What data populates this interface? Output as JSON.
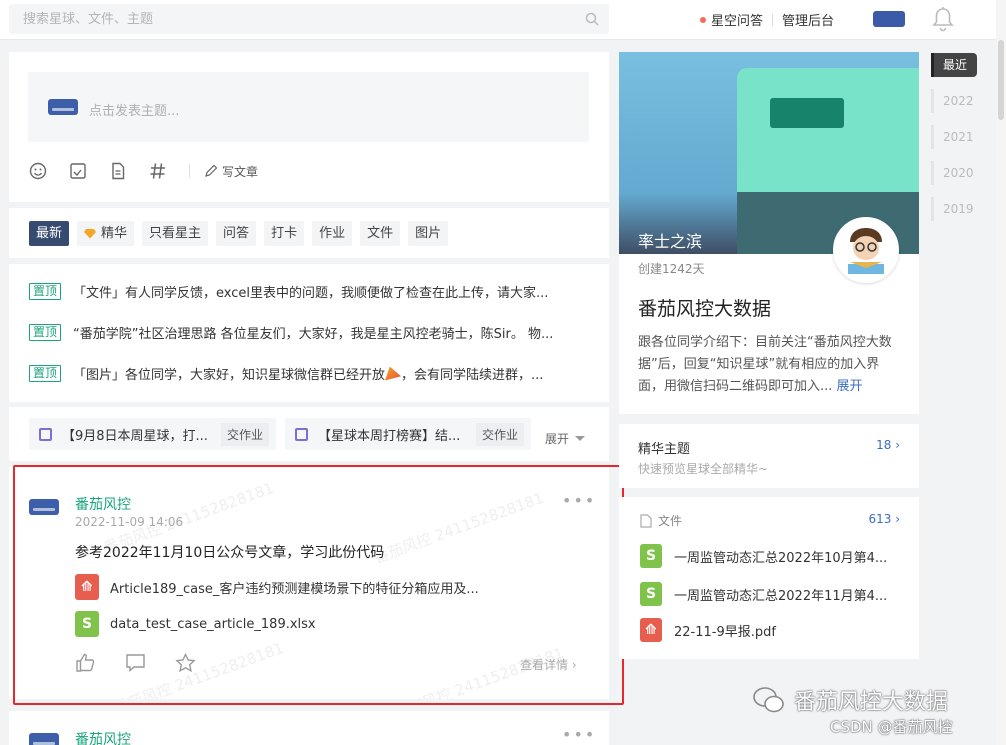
{
  "search": {
    "placeholder": "搜索星球、文件、主题"
  },
  "topnav": {
    "qa": "星空问答",
    "admin": "管理后台"
  },
  "composer": {
    "placeholder": "点击发表主题...",
    "write_article": "写文章"
  },
  "tabs": [
    "最新",
    "精华",
    "只看星主",
    "问答",
    "打卡",
    "作业",
    "文件",
    "图片"
  ],
  "pinned": {
    "tag": "置顶",
    "items": [
      "「文件」有人同学反馈，excel里表中的问题，我顺便做了检查在此上传，请大家...",
      "“番茄学院”社区治理思路 各位星友们，大家好，我是星主风控老骑士，陈Sir。 物...",
      "「图片」各位同学，大家好，知识星球微信群已经开放"
    ],
    "item3_tail": "，会有同学陆续进群，..."
  },
  "homework": {
    "items": [
      "【9月8日本周星球，打...",
      "【星球本周打榜赛】结..."
    ],
    "button": "交作业",
    "expand": "展开"
  },
  "post": {
    "author": "番茄风控",
    "time": "2022-11-09 14:06",
    "text": "参考2022年11月10日公众号文章，学习此份代码",
    "files": [
      "Article189_case_客户违约预测建模场景下的特征分箱应用及...",
      "data_test_case_article_189.xlsx"
    ],
    "detail": "查看详情",
    "watermark": "番茄风控 241152828181"
  },
  "post2": {
    "author": "番茄风控"
  },
  "group": {
    "banner_title": "率士之滨",
    "created": "创建1242天",
    "name": "番茄风控大数据",
    "desc": "跟各位同学介绍下：目前关注“番茄风控大数据”后，回复“知识星球”就有相应的加入界面，用微信扫码二维码即可加入...",
    "expand": "展开"
  },
  "essence": {
    "title": "精华主题",
    "count": "18",
    "sub": "快速预览星球全部精华~"
  },
  "files": {
    "title": "文件",
    "count": "613",
    "items": [
      "一周监管动态汇总2022年10月第4...",
      "一周监管动态汇总2022年11月第4...",
      "22-11-9早报.pdf"
    ]
  },
  "years": [
    "最近",
    "2022",
    "2021",
    "2020",
    "2019"
  ],
  "footer": {
    "wechat": "番茄风控大数据",
    "csdn": "CSDN @番茄风控"
  },
  "colors": {
    "accent_green": "#1ba57c",
    "highlight_red": "#e8272d",
    "tab_active": "#364b6f"
  }
}
